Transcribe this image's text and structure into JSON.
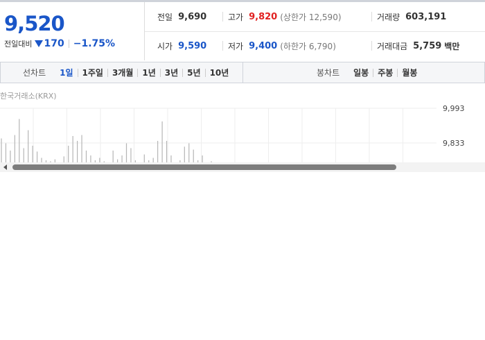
{
  "quote": {
    "price": "9,520",
    "diff_label": "전일대비",
    "diff_value": "170",
    "diff_rate": "−1.75%",
    "direction": "down",
    "colors": {
      "down": "#1a56c8",
      "up": "#e12121"
    }
  },
  "stats": {
    "prev_close": {
      "label": "전일",
      "value": "9,690"
    },
    "high": {
      "label": "고가",
      "value": "9,820",
      "sub": "(상한가 12,590)"
    },
    "volume": {
      "label": "거래량",
      "value": "603,191"
    },
    "open": {
      "label": "시가",
      "value": "9,590"
    },
    "low": {
      "label": "저가",
      "value": "9,400",
      "sub": "(하한가 6,790)"
    },
    "amount": {
      "label": "거래대금",
      "value": "5,759",
      "unit": "백만"
    }
  },
  "toolbar": {
    "line_title": "선차트",
    "line_periods": [
      "1일",
      "1주일",
      "3개월",
      "1년",
      "3년",
      "5년",
      "10년"
    ],
    "active_period": "1일",
    "candle_title": "봉차트",
    "candle_periods": [
      "일봉",
      "주봉",
      "월봉"
    ]
  },
  "chart": {
    "source": "한국거래소(KRX)",
    "y_ticks": [
      "9,993",
      "9,833"
    ]
  },
  "chart_data": {
    "type": "bar",
    "description_source": "한국거래소(KRX)",
    "ylim_labels": [
      "9,993",
      "9,833"
    ],
    "values": [
      0.55,
      0.45,
      0.3,
      0.62,
      0.95,
      0.35,
      0.72,
      0.4,
      0.28,
      0.15,
      0.1,
      0.08,
      0.12,
      0.05,
      0.18,
      0.4,
      0.6,
      0.5,
      0.62,
      0.3,
      0.2,
      0.1,
      0.15,
      0.08,
      0.05,
      0.3,
      0.12,
      0.2,
      0.45,
      0.35,
      0.1,
      0.05,
      0.22,
      0.1,
      0.15,
      0.5,
      0.9,
      0.5,
      0.2,
      0.05,
      0.1,
      0.38,
      0.45,
      0.32,
      0.1,
      0.2,
      0.05,
      0.08
    ]
  }
}
